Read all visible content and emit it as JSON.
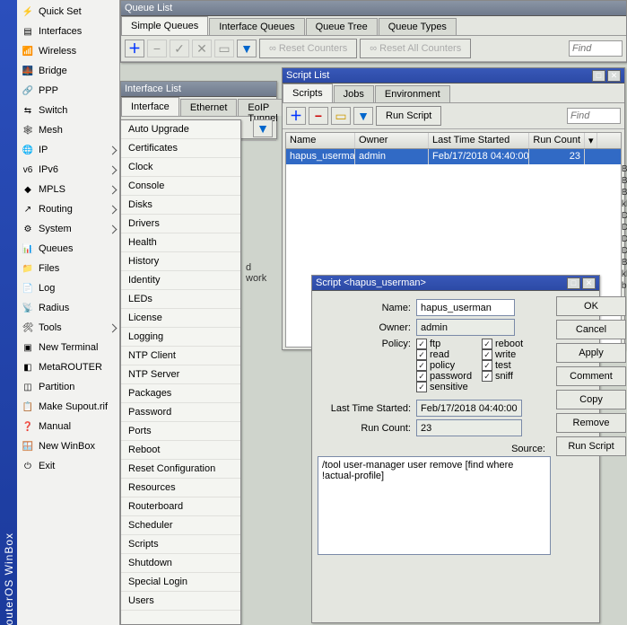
{
  "rail_label": "outerOS WinBox",
  "sidebar": [
    {
      "label": "Quick Set",
      "icon": "⚡"
    },
    {
      "label": "Interfaces",
      "icon": "▤"
    },
    {
      "label": "Wireless",
      "icon": "📶"
    },
    {
      "label": "Bridge",
      "icon": "🌉"
    },
    {
      "label": "PPP",
      "icon": "🔗"
    },
    {
      "label": "Switch",
      "icon": "⇆"
    },
    {
      "label": "Mesh",
      "icon": "🕸"
    },
    {
      "label": "IP",
      "icon": "🌐",
      "sub": true
    },
    {
      "label": "IPv6",
      "icon": "v6",
      "sub": true
    },
    {
      "label": "MPLS",
      "icon": "◆",
      "sub": true
    },
    {
      "label": "Routing",
      "icon": "↗",
      "sub": true
    },
    {
      "label": "System",
      "icon": "⚙",
      "sub": true
    },
    {
      "label": "Queues",
      "icon": "📊"
    },
    {
      "label": "Files",
      "icon": "📁"
    },
    {
      "label": "Log",
      "icon": "📄"
    },
    {
      "label": "Radius",
      "icon": "📡"
    },
    {
      "label": "Tools",
      "icon": "🛠",
      "sub": true
    },
    {
      "label": "New Terminal",
      "icon": "▣"
    },
    {
      "label": "MetaROUTER",
      "icon": "◧"
    },
    {
      "label": "Partition",
      "icon": "◫"
    },
    {
      "label": "Make Supout.rif",
      "icon": "📋"
    },
    {
      "label": "Manual",
      "icon": "❓"
    },
    {
      "label": "New WinBox",
      "icon": "🪟"
    },
    {
      "label": "Exit",
      "icon": "⏻"
    }
  ],
  "queue_win": {
    "title": "Queue List",
    "tabs": [
      "Simple Queues",
      "Interface Queues",
      "Queue Tree",
      "Queue Types"
    ],
    "reset1": "Reset Counters",
    "reset2": "Reset All Counters",
    "find": "Find"
  },
  "iface_win": {
    "title": "Interface List",
    "tabs": [
      "Interface",
      "Ethernet",
      "EoIP Tunnel"
    ]
  },
  "system_menu": [
    "Auto Upgrade",
    "Certificates",
    "Clock",
    "Console",
    "Disks",
    "Drivers",
    "Health",
    "History",
    "Identity",
    "LEDs",
    "License",
    "Logging",
    "NTP Client",
    "NTP Server",
    "Packages",
    "Password",
    "Ports",
    "Reboot",
    "Reset Configuration",
    "Resources",
    "Routerboard",
    "Scheduler",
    "Scripts",
    "Shutdown",
    "Special Login",
    "Users"
  ],
  "script_list": {
    "title": "Script List",
    "tabs": [
      "Scripts",
      "Jobs",
      "Environment"
    ],
    "run_label": "Run Script",
    "find": "Find",
    "headers": [
      "Name",
      "Owner",
      "Last Time Started",
      "Run Count"
    ],
    "row": {
      "name": "hapus_userman",
      "owner": "admin",
      "last": "Feb/17/2018 04:40:00",
      "count": "23"
    }
  },
  "script_win": {
    "title": "Script <hapus_userman>",
    "lbl_name": "Name:",
    "val_name": "hapus_userman",
    "lbl_owner": "Owner:",
    "val_owner": "admin",
    "lbl_policy": "Policy:",
    "policies": [
      {
        "label": "ftp",
        "c": true
      },
      {
        "label": "reboot",
        "c": true
      },
      {
        "label": "read",
        "c": true
      },
      {
        "label": "write",
        "c": true
      },
      {
        "label": "policy",
        "c": true
      },
      {
        "label": "test",
        "c": true
      },
      {
        "label": "password",
        "c": true
      },
      {
        "label": "sniff",
        "c": true
      },
      {
        "label": "sensitive",
        "c": true
      }
    ],
    "lbl_last": "Last Time Started:",
    "val_last": "Feb/17/2018 04:40:00",
    "lbl_count": "Run Count:",
    "val_count": "23",
    "lbl_source": "Source:",
    "val_source": "/tool user-manager user remove [find where !actual-profile]",
    "btns": [
      "OK",
      "Cancel",
      "Apply",
      "Comment",
      "Copy",
      "Remove",
      "Run Script"
    ]
  },
  "bg_text1": "d\nwork"
}
